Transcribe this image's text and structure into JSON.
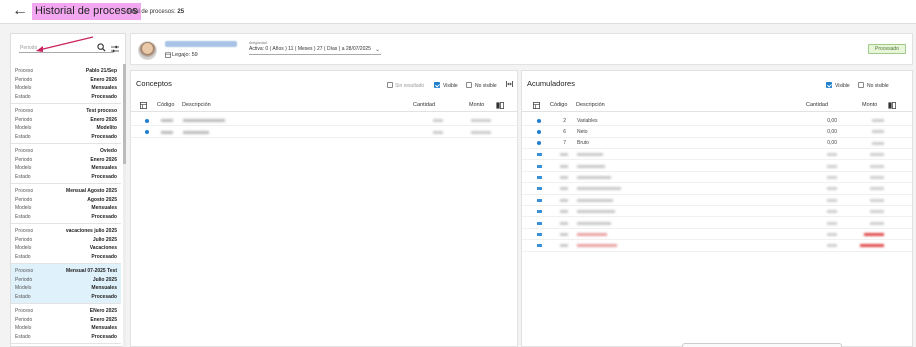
{
  "header": {
    "title": "Historial de procesos",
    "total_label": "Total de procesos:",
    "total_value": "25"
  },
  "sidebar": {
    "search_placeholder": "Periodo",
    "labels": {
      "proceso": "Proceso",
      "periodo": "Periodo",
      "modelo": "Modelo",
      "estado": "Estado"
    },
    "items": [
      {
        "proceso": "Pablo 21/Sep",
        "periodo": "Enero 2026",
        "modelo": "Mensuales",
        "estado": "Procesado",
        "selected": false
      },
      {
        "proceso": "Test proceso",
        "periodo": "Enero 2026",
        "modelo": "Modelito",
        "estado": "Procesado",
        "selected": false
      },
      {
        "proceso": "Oviedo",
        "periodo": "Enero 2026",
        "modelo": "Mensuales",
        "estado": "Procesado",
        "selected": false
      },
      {
        "proceso": "Mensual Agosto 2025",
        "periodo": "Agosto 2025",
        "modelo": "Mensuales",
        "estado": "Procesado",
        "selected": false
      },
      {
        "proceso": "vacaciones julio 2025",
        "periodo": "Julio 2025",
        "modelo": "Vacaciones",
        "estado": "Procesado",
        "selected": false
      },
      {
        "proceso": "Mensual 07-2025 Test",
        "periodo": "Julio 2025",
        "modelo": "Mensuales",
        "estado": "Procesado",
        "selected": true
      },
      {
        "proceso": "ENero 2025",
        "periodo": "Enero 2025",
        "modelo": "Mensuales",
        "estado": "Procesado",
        "selected": false
      }
    ]
  },
  "employee": {
    "legajo": "Legajo: 59",
    "antiguedad_label": "Antigüedad",
    "antiguedad_value": "Activa: 0 ( Años ) 11 ( Meses ) 27 ( Días ) a 28/07/2025",
    "status": "Procesado"
  },
  "conceptos": {
    "title": "Conceptos",
    "filters": {
      "sin_resultado": "Sin resultado",
      "visible": "Visible",
      "no_visible": "No visible"
    },
    "columns": {
      "codigo": "Código",
      "descripcion": "Descripción",
      "cantidad": "Cantidad",
      "monto": "Monto"
    }
  },
  "acumuladores": {
    "title": "Acumuladores",
    "filters": {
      "visible": "Visible",
      "no_visible": "No visible"
    },
    "columns": {
      "codigo": "Código",
      "descripcion": "Descripción",
      "cantidad": "Cantidad",
      "monto": "Monto"
    },
    "rows": [
      {
        "codigo": "2",
        "descripcion": "Variables",
        "cantidad": "0,00"
      },
      {
        "codigo": "6",
        "descripcion": "Neto",
        "cantidad": "0,00"
      },
      {
        "codigo": "7",
        "descripcion": "Bruto",
        "cantidad": "0,00"
      },
      {
        "codigo": "",
        "descripcion": "",
        "cantidad": ""
      },
      {
        "codigo": "",
        "descripcion": "",
        "cantidad": ""
      },
      {
        "codigo": "",
        "descripcion": "",
        "cantidad": ""
      },
      {
        "codigo": "",
        "descripcion": "",
        "cantidad": ""
      },
      {
        "codigo": "",
        "descripcion": "",
        "cantidad": ""
      },
      {
        "codigo": "",
        "descripcion": "",
        "cantidad": ""
      },
      {
        "codigo": "",
        "descripcion": "",
        "cantidad": ""
      },
      {
        "codigo": "",
        "descripcion": "",
        "cantidad": ""
      },
      {
        "codigo": "",
        "descripcion": "",
        "cantidad": ""
      }
    ]
  }
}
